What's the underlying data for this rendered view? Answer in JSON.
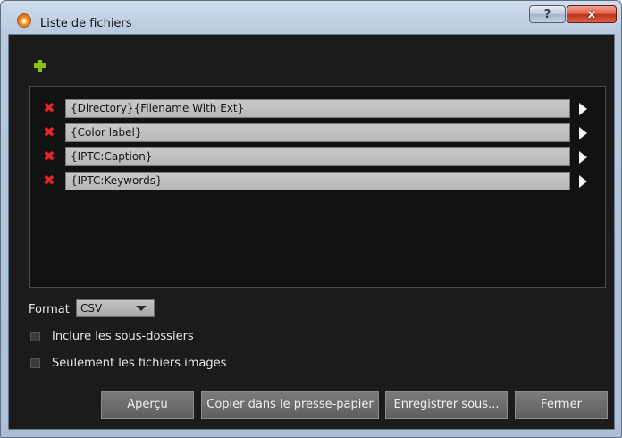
{
  "window": {
    "title": "Liste de fichiers",
    "help_label": "?",
    "close_label": "x"
  },
  "toolbar": {
    "add_icon": "plus-icon"
  },
  "fields": [
    {
      "value": "{Directory}{Filename With Ext}"
    },
    {
      "value": "{Color label}"
    },
    {
      "value": "{IPTC:Caption}"
    },
    {
      "value": "{IPTC:Keywords}"
    }
  ],
  "icons": {
    "delete": "delete-x-icon",
    "expand": "play-arrow-icon"
  },
  "format": {
    "label": "Format",
    "selected": "CSV"
  },
  "options": {
    "include_subfolders": {
      "label": "Inclure les sous-dossiers",
      "checked": false
    },
    "images_only": {
      "label": "Seulement les fichiers images",
      "checked": false
    }
  },
  "buttons": {
    "preview": "Aperçu",
    "copy": "Copier dans le presse-papier",
    "save_as": "Enregistrer sous...",
    "close": "Fermer"
  },
  "colors": {
    "add_icon": "#8bc21a",
    "delete_icon": "#e0282a",
    "background": "#1b1b1b"
  }
}
